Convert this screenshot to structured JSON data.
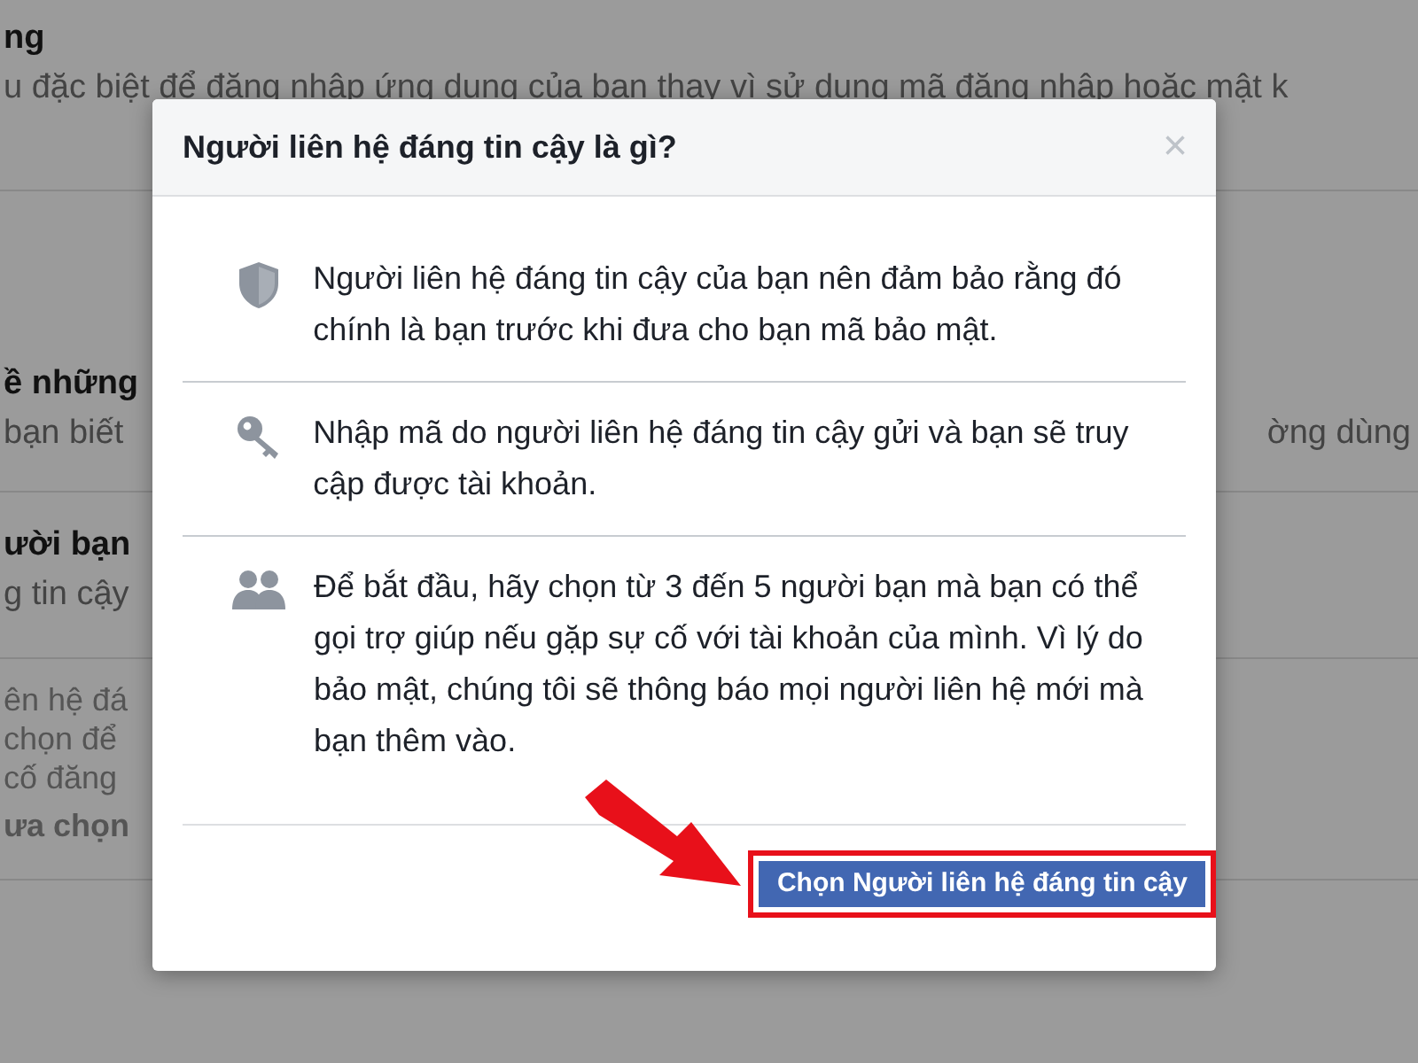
{
  "background_page": {
    "sections": [
      {
        "lines": [
          {
            "kind": "heading",
            "text": "ng"
          },
          {
            "kind": "text",
            "text": "u đặc biệt để đăng nhập ứng dụng của bạn thay vì sử dụng mã đăng nhập hoặc mật k"
          }
        ]
      },
      {
        "lines": [
          {
            "kind": "heading",
            "text": "ề những"
          },
          {
            "kind": "text",
            "text": "bạn biết",
            "side_text": "ờng dùng"
          }
        ]
      },
      {
        "lines": [
          {
            "kind": "heading",
            "text": "ười bạn"
          },
          {
            "kind": "text",
            "text": "g tin cậy"
          }
        ]
      },
      {
        "lines": [
          {
            "kind": "note",
            "text": "ên hệ đá"
          },
          {
            "kind": "note",
            "text": "chọn để"
          },
          {
            "kind": "note",
            "text": "cố đăng"
          },
          {
            "kind": "subheading",
            "text": "ưa chọn"
          }
        ]
      }
    ]
  },
  "dialog": {
    "title": "Người liên hệ đáng tin cậy là gì?",
    "close": "×",
    "items": [
      {
        "kind": "shield",
        "text": "Người liên hệ đáng tin cậy của bạn nên đảm bảo rằng đó chính là bạn trước khi đưa cho bạn mã bảo mật."
      },
      {
        "kind": "key",
        "text": "Nhập mã do người liên hệ đáng tin cậy gửi và bạn sẽ truy cập được tài khoản."
      },
      {
        "kind": "people",
        "text": "Để bắt đầu, hãy chọn từ 3 đến 5 người bạn mà bạn có thể gọi trợ giúp nếu gặp sự cố với tài khoản của mình. Vì lý do bảo mật, chúng tôi sẽ thông báo mọi người liên hệ mới mà bạn thêm vào."
      }
    ],
    "button": "Chọn Người liên hệ đáng tin cậy"
  }
}
